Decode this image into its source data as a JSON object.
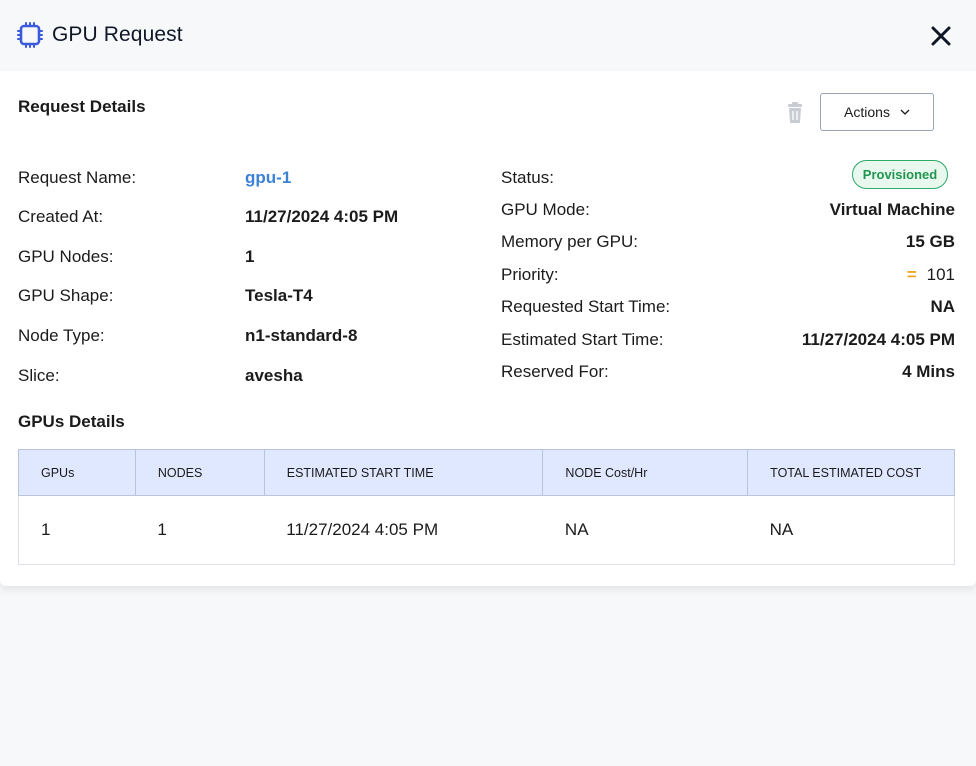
{
  "header": {
    "title": "GPU Request"
  },
  "request_details": {
    "heading": "Request Details",
    "actions_label": "Actions",
    "left_fields": [
      {
        "label": "Request Name:",
        "value": "gpu-1"
      },
      {
        "label": "Created At:",
        "value": "11/27/2024 4:05 PM"
      },
      {
        "label": "GPU Nodes:",
        "value": "1"
      },
      {
        "label": "GPU Shape:",
        "value": "Tesla-T4"
      },
      {
        "label": "Node Type:",
        "value": "n1-standard-8"
      },
      {
        "label": "Slice:",
        "value": "avesha"
      }
    ],
    "right_fields": [
      {
        "label": "Status:",
        "value": "Provisioned"
      },
      {
        "label": "GPU Mode:",
        "value": "Virtual Machine"
      },
      {
        "label": "Memory per GPU:",
        "value": "15 GB"
      },
      {
        "label": "Priority:",
        "value": "101"
      },
      {
        "label": "Requested Start Time:",
        "value": "NA"
      },
      {
        "label": "Estimated Start Time:",
        "value": "11/27/2024 4:05 PM"
      },
      {
        "label": "Reserved For:",
        "value": "4 Mins"
      }
    ],
    "priority_icon": "equals-icon"
  },
  "gpus_details": {
    "heading": "GPUs Details",
    "columns": [
      "GPUs",
      "NODES",
      "ESTIMATED START TIME",
      "NODE Cost/Hr",
      "TOTAL ESTIMATED COST"
    ],
    "rows": [
      [
        "1",
        "1",
        "11/27/2024 4:05 PM",
        "NA",
        "NA"
      ]
    ]
  },
  "colors": {
    "accent_link": "#3b82d6",
    "status_green": "#20954f",
    "priority_orange": "#f5a623",
    "chip_blue": "#3b5bdb",
    "table_header_bg": "#dfe8ff"
  }
}
